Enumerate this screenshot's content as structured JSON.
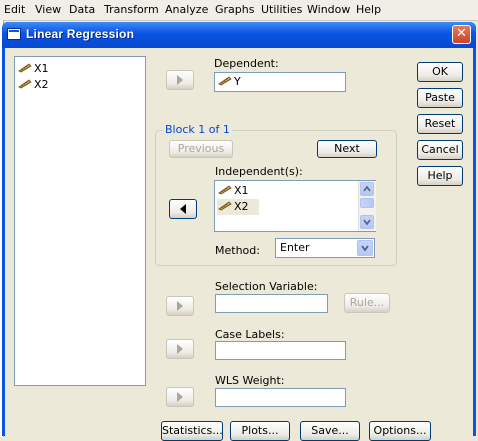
{
  "menu": [
    "Edit",
    "View",
    "Data",
    "Transform",
    "Analyze",
    "Graphs",
    "Utilities",
    "Window",
    "Help"
  ],
  "dialog": {
    "title": "Linear Regression"
  },
  "source_vars": [
    "X1",
    "X2"
  ],
  "dependent": {
    "label": "Dependent:",
    "value": "Y"
  },
  "block": {
    "label": "Block 1 of 1",
    "previous": "Previous",
    "next": "Next"
  },
  "independents": {
    "label": "Independent(s):",
    "vars": [
      "X1",
      "X2"
    ]
  },
  "method": {
    "label": "Method:",
    "value": "Enter"
  },
  "selection": {
    "label": "Selection Variable:",
    "rule": "Rule..."
  },
  "case_labels": {
    "label": "Case Labels:"
  },
  "wls": {
    "label": "WLS Weight:"
  },
  "side_buttons": {
    "ok": "OK",
    "paste": "Paste",
    "reset": "Reset",
    "cancel": "Cancel",
    "help": "Help"
  },
  "bottom_buttons": {
    "statistics": "Statistics...",
    "plots": "Plots...",
    "save": "Save...",
    "options": "Options..."
  },
  "colors": {
    "titlebar": "#0a54e4",
    "variable_icon": "#c8a050",
    "close_button": "#d8583a"
  }
}
